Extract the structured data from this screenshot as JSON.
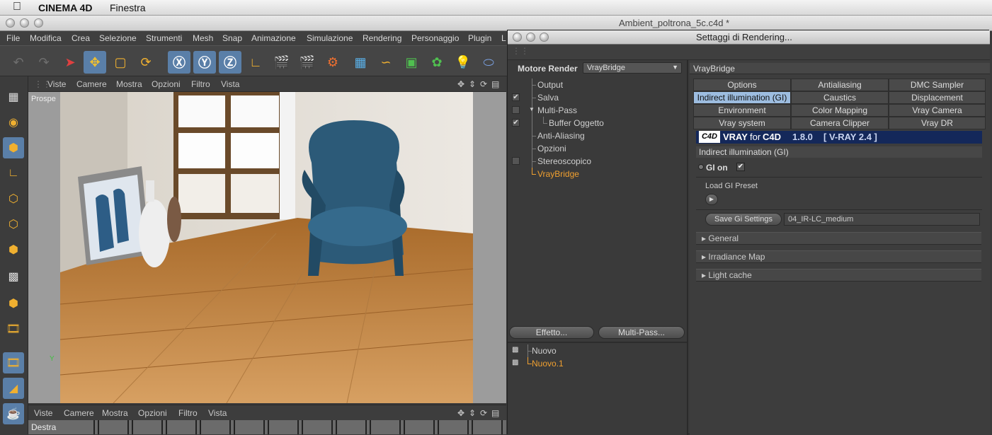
{
  "mac": {
    "app_name": "CINEMA 4D",
    "menu": "Finestra"
  },
  "main_window": {
    "title": "Ambient_poltrona_5c.c4d *"
  },
  "c4d_menu": [
    "File",
    "Modifica",
    "Crea",
    "Selezione",
    "Strumenti",
    "Mesh",
    "Snap",
    "Animazione",
    "Simulazione",
    "Rendering",
    "Personaggio",
    "Plugin",
    "L"
  ],
  "viewport": {
    "menu": [
      "Viste",
      "Camere",
      "Mostra",
      "Opzioni",
      "Filtro",
      "Vista"
    ],
    "label": "Prospe",
    "bottom_menu": [
      "Viste",
      "Camere",
      "Mostra",
      "Opzioni",
      "Filtro",
      "Vista"
    ],
    "bottom_label": "Destra"
  },
  "render_settings": {
    "title": "Settaggi di Rendering...",
    "renderer_label": "Motore Render",
    "renderer_value": "VrayBridge",
    "tree": [
      {
        "label": "Output",
        "checked": false,
        "has_check": false,
        "indent": 0,
        "active": false
      },
      {
        "label": "Salva",
        "checked": true,
        "has_check": true,
        "indent": 0,
        "active": false
      },
      {
        "label": "Multi-Pass",
        "checked": false,
        "has_check": true,
        "indent": 0,
        "active": false
      },
      {
        "label": "Buffer Oggetto",
        "checked": true,
        "has_check": true,
        "indent": 1,
        "active": false
      },
      {
        "label": "Anti-Aliasing",
        "checked": false,
        "has_check": false,
        "indent": 0,
        "active": false
      },
      {
        "label": "Opzioni",
        "checked": false,
        "has_check": false,
        "indent": 0,
        "active": false
      },
      {
        "label": "Stereoscopico",
        "checked": false,
        "has_check": true,
        "indent": 0,
        "active": false
      },
      {
        "label": "VrayBridge",
        "checked": false,
        "has_check": false,
        "indent": 0,
        "active": true
      }
    ],
    "effect_button": "Effetto...",
    "multipass_button": "Multi-Pass...",
    "presets": [
      "Nuovo",
      "Nuovo.1"
    ],
    "panel_title": "VrayBridge",
    "tabs": [
      [
        "Options",
        "Antialiasing",
        "DMC Sampler"
      ],
      [
        "Indirect illumination (GI)",
        "Caustics",
        "Displacement"
      ],
      [
        "Environment",
        "Color Mapping",
        "Vray Camera"
      ],
      [
        "Vray system",
        "Camera Clipper",
        "Vray DR"
      ]
    ],
    "banner": {
      "logo": "C4D",
      "vray": "VRAY",
      "for": "for",
      "c4d": "C4D",
      "version": "1.8.0",
      "engine": "[ V-RAY 2.4 ]"
    },
    "section_title": "Indirect illumination (GI)",
    "gi_on_label": "GI on",
    "load_preset_label": "Load GI Preset",
    "save_button": "Save Gi Settings",
    "save_value": "04_IR-LC_medium",
    "sections": [
      "General",
      "Irradiance Map",
      "Light cache"
    ]
  },
  "colors": {
    "accent": "#5a7fa8",
    "active_text": "#f0a030",
    "tab_active": "#9dbde0",
    "banner": "#14285a"
  }
}
